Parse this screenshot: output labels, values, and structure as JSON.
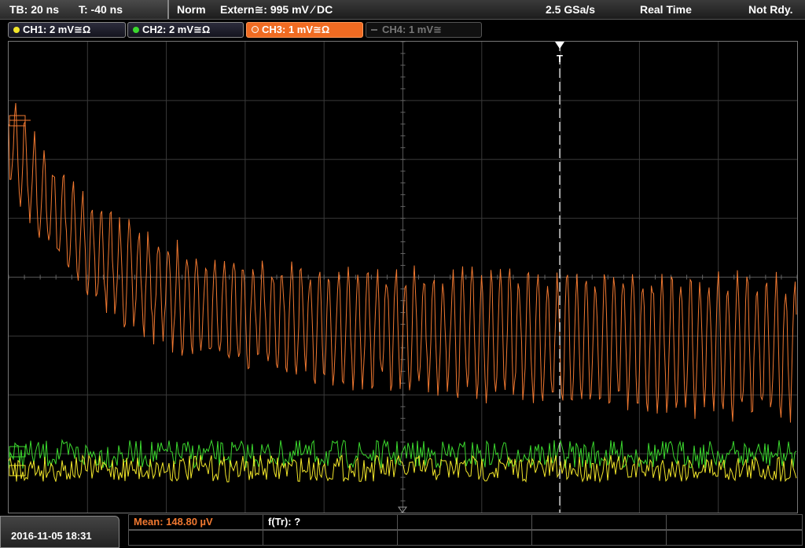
{
  "status_bar": {
    "timebase": "TB: 20 ns",
    "trigger_time": "T: -40 ns",
    "trigger_mode": "Norm",
    "trigger_source": "Extern≅: 995 mV ⁄ DC",
    "sample_rate": "2.5 GSa/s",
    "acquisition_mode": "Real Time",
    "state": "Not Rdy."
  },
  "channels": [
    {
      "label": "CH1: 2 mV≅Ω",
      "color": "#f2e62a"
    },
    {
      "label": "CH2: 2 mV≅Ω",
      "color": "#3bd82e"
    },
    {
      "label": "CH3: 1 mV≅Ω",
      "color": "#f07830"
    },
    {
      "label": "CH4: 1 mV≅",
      "color": "#666666"
    }
  ],
  "trigger_marker": "T",
  "measurements": {
    "mean": "Mean: 148.80 µV",
    "rise_freq": "f(Tr): ?"
  },
  "datetime": "2016-11-05 18:31",
  "colors": {
    "ch3": "#f07830",
    "ch2": "#3bd82e",
    "ch1": "#f2e62a",
    "grid": "#3a3a3a"
  }
}
